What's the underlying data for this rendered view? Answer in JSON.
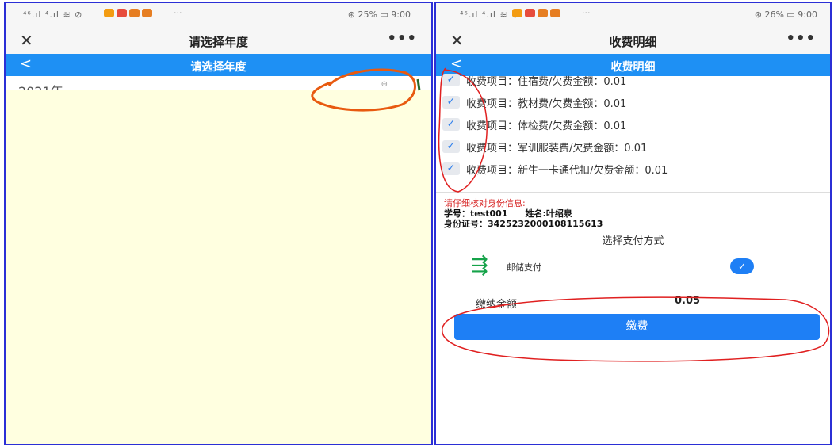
{
  "left_phone": {
    "status": {
      "signal": "⁴⁶.ıl ⁴.ıl ≋ ⊘",
      "battery_percent": "25%",
      "time": "9:00",
      "right_text": "⊛ 25% ▭ 9:00",
      "dots": "···"
    },
    "title_bar": {
      "close_icon": "✕",
      "title": "请选择年度",
      "more": "•••"
    },
    "nav_bar": {
      "back": "<",
      "title": "请选择年度"
    },
    "year_list": [
      {
        "label": "2021年",
        "arrow": "⊖"
      }
    ]
  },
  "right_phone": {
    "status": {
      "signal": "⁴⁶.ıl ⁴.ıl ≋ ⊘",
      "right_text": "⊛ 26% ▭ 9:00",
      "dots": "···"
    },
    "title_bar": {
      "close_icon": "✕",
      "title": "收费明细",
      "more": "•••"
    },
    "nav_bar": {
      "back": "<",
      "title": "收费明细"
    },
    "fee_items": [
      {
        "check": "✓",
        "text": "收费项目：住宿费/欠费金额：0.01"
      },
      {
        "check": "✓",
        "text": "收费项目：教材费/欠费金额：0.01"
      },
      {
        "check": "✓",
        "text": "收费项目：体检费/欠费金额：0.01"
      },
      {
        "check": "✓",
        "text": "收费项目：军训服装费/欠费金额：0.01"
      },
      {
        "check": "✓",
        "text": "收费项目：新生一卡通代扣/欠费金额：0.01"
      }
    ],
    "verify": {
      "warning": "请仔细核对身份信息:",
      "student_id_label": "学号：test001",
      "name_label": "姓名:叶绍泉",
      "id_card_label": "身份证号：342523200010811561​3"
    },
    "payment": {
      "section_title": "选择支付方式",
      "method_logo": "⇶",
      "method_name": "邮储支付",
      "method_check": "✓",
      "amount_label": "缴纳金额",
      "amount_value": "0.05",
      "pay_button": "缴费"
    }
  },
  "colors": {
    "primary_blue": "#1e90f4",
    "button_blue": "#1e7ff5",
    "annotation_red": "#e02020",
    "frame_blue": "#2b2fd6",
    "year_body_bg": "#ffffe0"
  }
}
